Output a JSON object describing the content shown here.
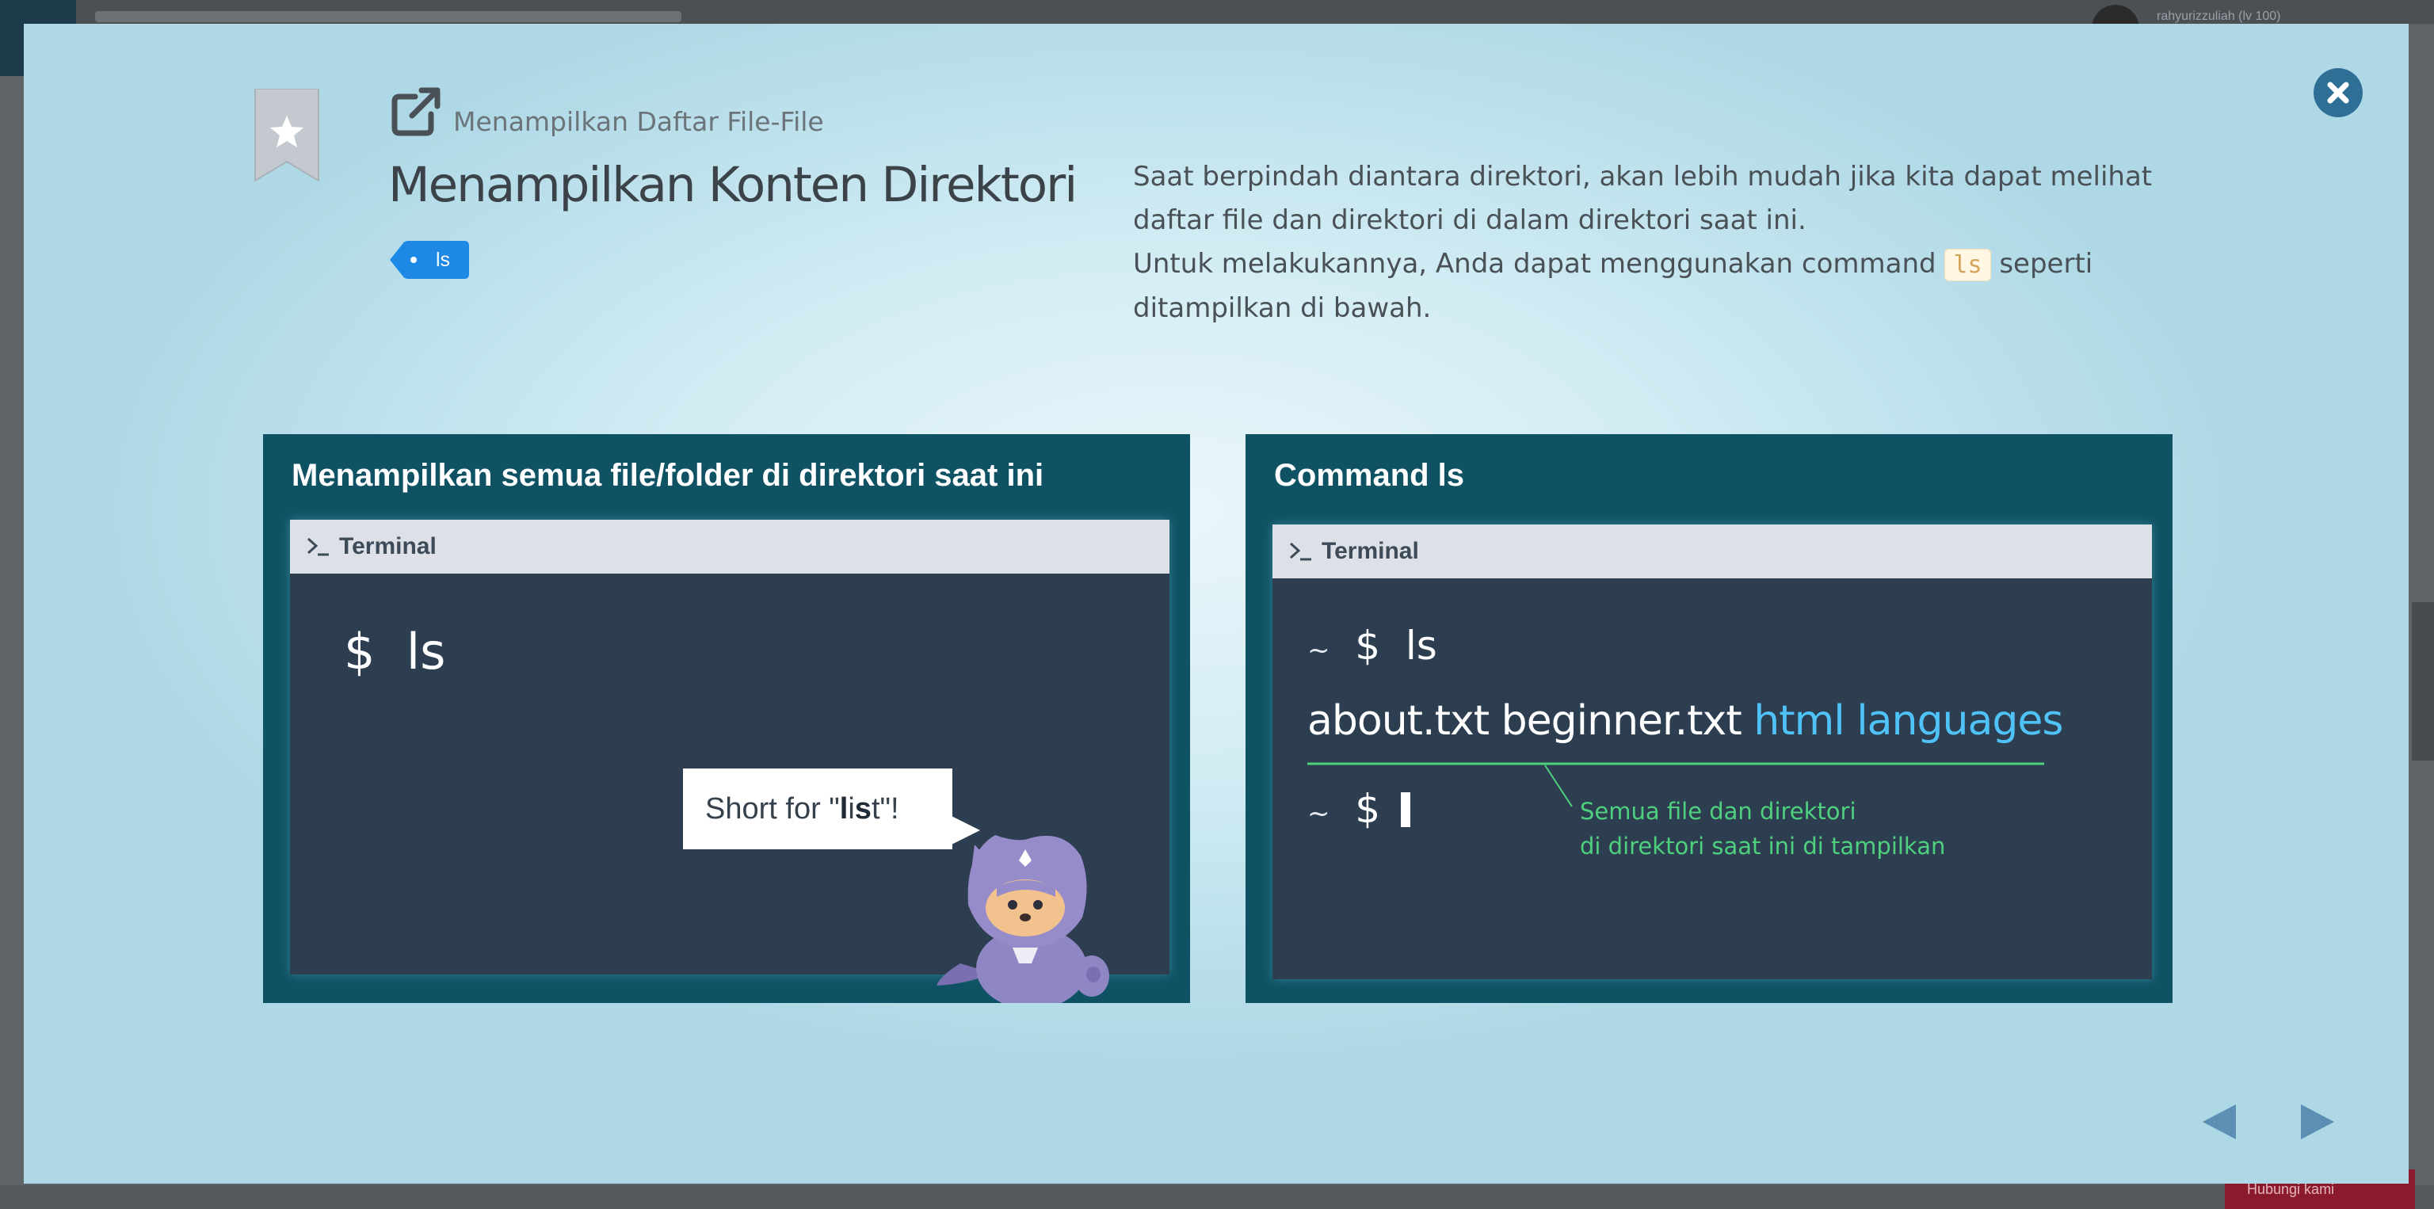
{
  "background": {
    "username": "rahyurizzuliah (lv 100)",
    "bottom_button": "Hubungi kami"
  },
  "modal": {
    "subtitle": "Menampilkan Daftar File-File",
    "title": "Menampilkan Konten Direktori",
    "tag": "ls",
    "description": {
      "p1": "Saat berpindah diantara direktori, akan lebih mudah jika kita dapat melihat daftar file dan direktori di dalam direktori saat ini.",
      "p2_before": "Untuk melakukannya, Anda dapat menggunakan command ",
      "p2_code": "ls",
      "p2_after": " seperti ditampilkan di bawah."
    },
    "colors": {
      "panel_bg": "#0f5264",
      "terminal_bg": "#2c3e50",
      "close_button": "#2f6f96",
      "tag_bg": "#1e88e5",
      "directory_text": "#4fc3f7",
      "annotation_text": "#4fd07e"
    }
  },
  "left_panel": {
    "heading": "Menampilkan semua file/folder di direktori saat ini",
    "terminal_label": "Terminal",
    "prompt": "$",
    "command": "ls",
    "bubble_prefix": "Short for \"",
    "bubble_bold1": "l",
    "bubble_mid": "i",
    "bubble_bold2": "s",
    "bubble_suffix": "t\"!"
  },
  "right_panel": {
    "heading": "Command ls",
    "terminal_label": "Terminal",
    "tilde": "~",
    "prompt": "$",
    "command": "ls",
    "files": [
      "about.txt",
      "beginner.txt"
    ],
    "directories": [
      "html",
      "languages"
    ],
    "annotation_line1": "Semua file dan direktori",
    "annotation_line2": "di direktori saat ini di tampilkan"
  },
  "icons": {
    "close": "close-icon",
    "bookmark": "bookmark-star-icon",
    "external_link": "external-link-icon",
    "terminal": "terminal-prompt-icon",
    "prev": "prev-arrow-icon",
    "next": "next-arrow-icon"
  }
}
